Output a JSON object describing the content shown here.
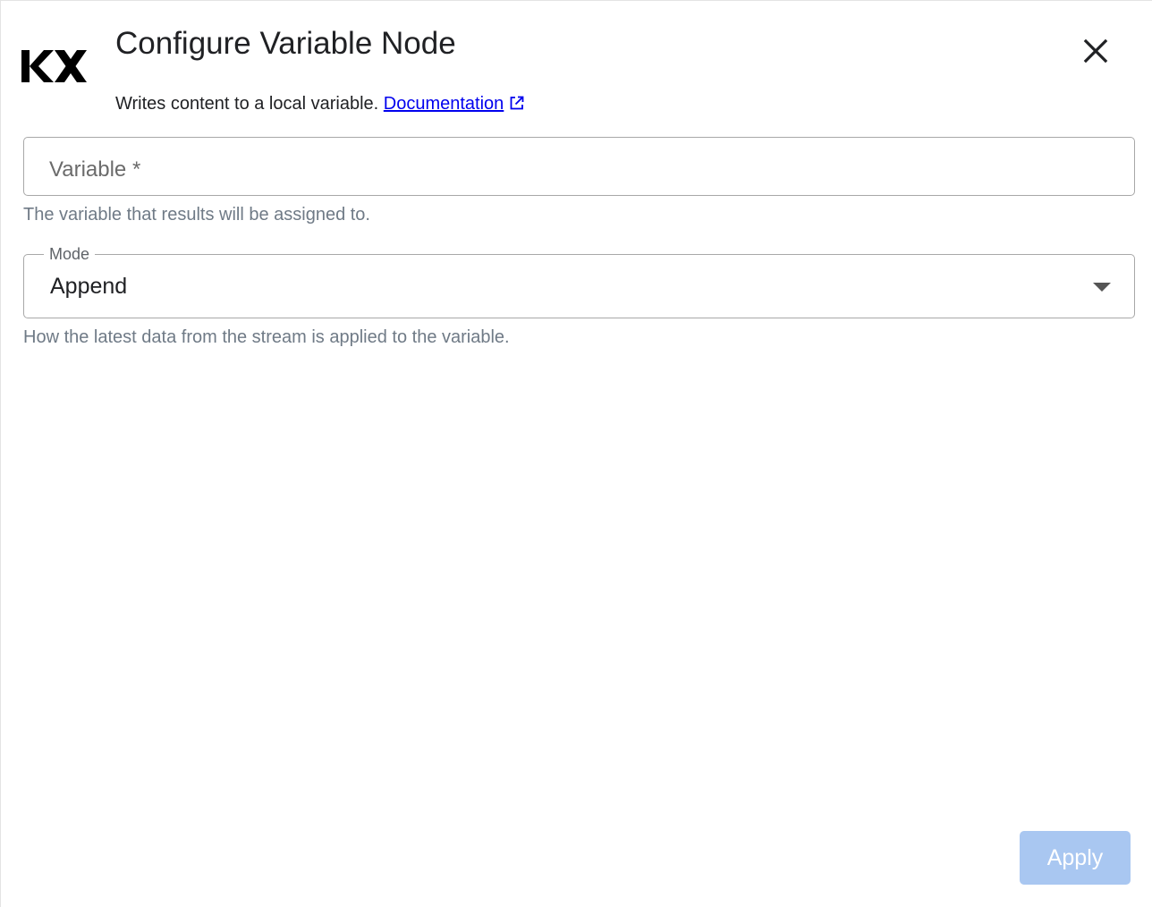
{
  "dialog": {
    "logo_text": "KX",
    "title": "Configure Variable Node",
    "subtitle": "Writes content to a local variable.",
    "doc_link_label": "Documentation",
    "doc_link_icon": "external-link-icon",
    "close_icon": "close-icon"
  },
  "form": {
    "variable": {
      "placeholder": "Variable *",
      "value": "",
      "helper": "The variable that results will be assigned to."
    },
    "mode": {
      "label": "Mode",
      "selected": "Append",
      "dropdown_icon": "chevron-down-icon",
      "helper": "How the latest data from the stream is applied to the variable."
    }
  },
  "footer": {
    "apply_label": "Apply",
    "apply_enabled": false
  },
  "colors": {
    "link": "#0000ee",
    "apply_disabled_bg": "#a9c7f1",
    "helper_text": "#6f7a86"
  }
}
